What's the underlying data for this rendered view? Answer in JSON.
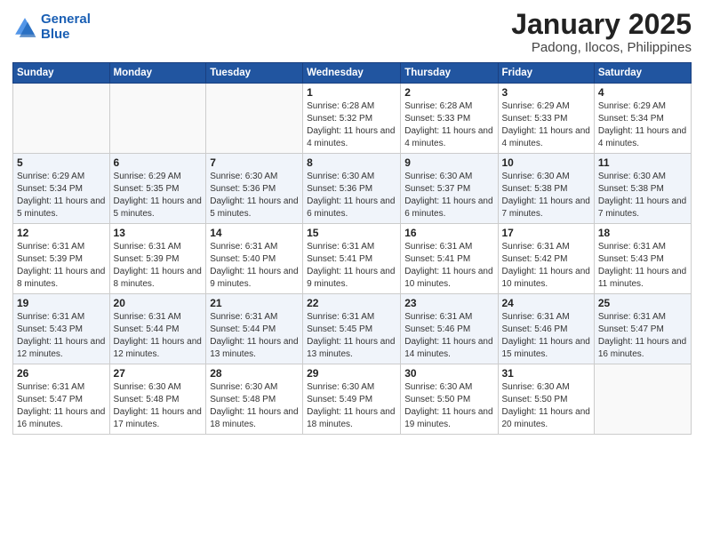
{
  "header": {
    "logo_line1": "General",
    "logo_line2": "Blue",
    "month": "January 2025",
    "location": "Padong, Ilocos, Philippines"
  },
  "weekdays": [
    "Sunday",
    "Monday",
    "Tuesday",
    "Wednesday",
    "Thursday",
    "Friday",
    "Saturday"
  ],
  "weeks": [
    [
      {
        "day": "",
        "info": ""
      },
      {
        "day": "",
        "info": ""
      },
      {
        "day": "",
        "info": ""
      },
      {
        "day": "1",
        "info": "Sunrise: 6:28 AM\nSunset: 5:32 PM\nDaylight: 11 hours and 4 minutes."
      },
      {
        "day": "2",
        "info": "Sunrise: 6:28 AM\nSunset: 5:33 PM\nDaylight: 11 hours and 4 minutes."
      },
      {
        "day": "3",
        "info": "Sunrise: 6:29 AM\nSunset: 5:33 PM\nDaylight: 11 hours and 4 minutes."
      },
      {
        "day": "4",
        "info": "Sunrise: 6:29 AM\nSunset: 5:34 PM\nDaylight: 11 hours and 4 minutes."
      }
    ],
    [
      {
        "day": "5",
        "info": "Sunrise: 6:29 AM\nSunset: 5:34 PM\nDaylight: 11 hours and 5 minutes."
      },
      {
        "day": "6",
        "info": "Sunrise: 6:29 AM\nSunset: 5:35 PM\nDaylight: 11 hours and 5 minutes."
      },
      {
        "day": "7",
        "info": "Sunrise: 6:30 AM\nSunset: 5:36 PM\nDaylight: 11 hours and 5 minutes."
      },
      {
        "day": "8",
        "info": "Sunrise: 6:30 AM\nSunset: 5:36 PM\nDaylight: 11 hours and 6 minutes."
      },
      {
        "day": "9",
        "info": "Sunrise: 6:30 AM\nSunset: 5:37 PM\nDaylight: 11 hours and 6 minutes."
      },
      {
        "day": "10",
        "info": "Sunrise: 6:30 AM\nSunset: 5:38 PM\nDaylight: 11 hours and 7 minutes."
      },
      {
        "day": "11",
        "info": "Sunrise: 6:30 AM\nSunset: 5:38 PM\nDaylight: 11 hours and 7 minutes."
      }
    ],
    [
      {
        "day": "12",
        "info": "Sunrise: 6:31 AM\nSunset: 5:39 PM\nDaylight: 11 hours and 8 minutes."
      },
      {
        "day": "13",
        "info": "Sunrise: 6:31 AM\nSunset: 5:39 PM\nDaylight: 11 hours and 8 minutes."
      },
      {
        "day": "14",
        "info": "Sunrise: 6:31 AM\nSunset: 5:40 PM\nDaylight: 11 hours and 9 minutes."
      },
      {
        "day": "15",
        "info": "Sunrise: 6:31 AM\nSunset: 5:41 PM\nDaylight: 11 hours and 9 minutes."
      },
      {
        "day": "16",
        "info": "Sunrise: 6:31 AM\nSunset: 5:41 PM\nDaylight: 11 hours and 10 minutes."
      },
      {
        "day": "17",
        "info": "Sunrise: 6:31 AM\nSunset: 5:42 PM\nDaylight: 11 hours and 10 minutes."
      },
      {
        "day": "18",
        "info": "Sunrise: 6:31 AM\nSunset: 5:43 PM\nDaylight: 11 hours and 11 minutes."
      }
    ],
    [
      {
        "day": "19",
        "info": "Sunrise: 6:31 AM\nSunset: 5:43 PM\nDaylight: 11 hours and 12 minutes."
      },
      {
        "day": "20",
        "info": "Sunrise: 6:31 AM\nSunset: 5:44 PM\nDaylight: 11 hours and 12 minutes."
      },
      {
        "day": "21",
        "info": "Sunrise: 6:31 AM\nSunset: 5:44 PM\nDaylight: 11 hours and 13 minutes."
      },
      {
        "day": "22",
        "info": "Sunrise: 6:31 AM\nSunset: 5:45 PM\nDaylight: 11 hours and 13 minutes."
      },
      {
        "day": "23",
        "info": "Sunrise: 6:31 AM\nSunset: 5:46 PM\nDaylight: 11 hours and 14 minutes."
      },
      {
        "day": "24",
        "info": "Sunrise: 6:31 AM\nSunset: 5:46 PM\nDaylight: 11 hours and 15 minutes."
      },
      {
        "day": "25",
        "info": "Sunrise: 6:31 AM\nSunset: 5:47 PM\nDaylight: 11 hours and 16 minutes."
      }
    ],
    [
      {
        "day": "26",
        "info": "Sunrise: 6:31 AM\nSunset: 5:47 PM\nDaylight: 11 hours and 16 minutes."
      },
      {
        "day": "27",
        "info": "Sunrise: 6:30 AM\nSunset: 5:48 PM\nDaylight: 11 hours and 17 minutes."
      },
      {
        "day": "28",
        "info": "Sunrise: 6:30 AM\nSunset: 5:48 PM\nDaylight: 11 hours and 18 minutes."
      },
      {
        "day": "29",
        "info": "Sunrise: 6:30 AM\nSunset: 5:49 PM\nDaylight: 11 hours and 18 minutes."
      },
      {
        "day": "30",
        "info": "Sunrise: 6:30 AM\nSunset: 5:50 PM\nDaylight: 11 hours and 19 minutes."
      },
      {
        "day": "31",
        "info": "Sunrise: 6:30 AM\nSunset: 5:50 PM\nDaylight: 11 hours and 20 minutes."
      },
      {
        "day": "",
        "info": ""
      }
    ]
  ]
}
